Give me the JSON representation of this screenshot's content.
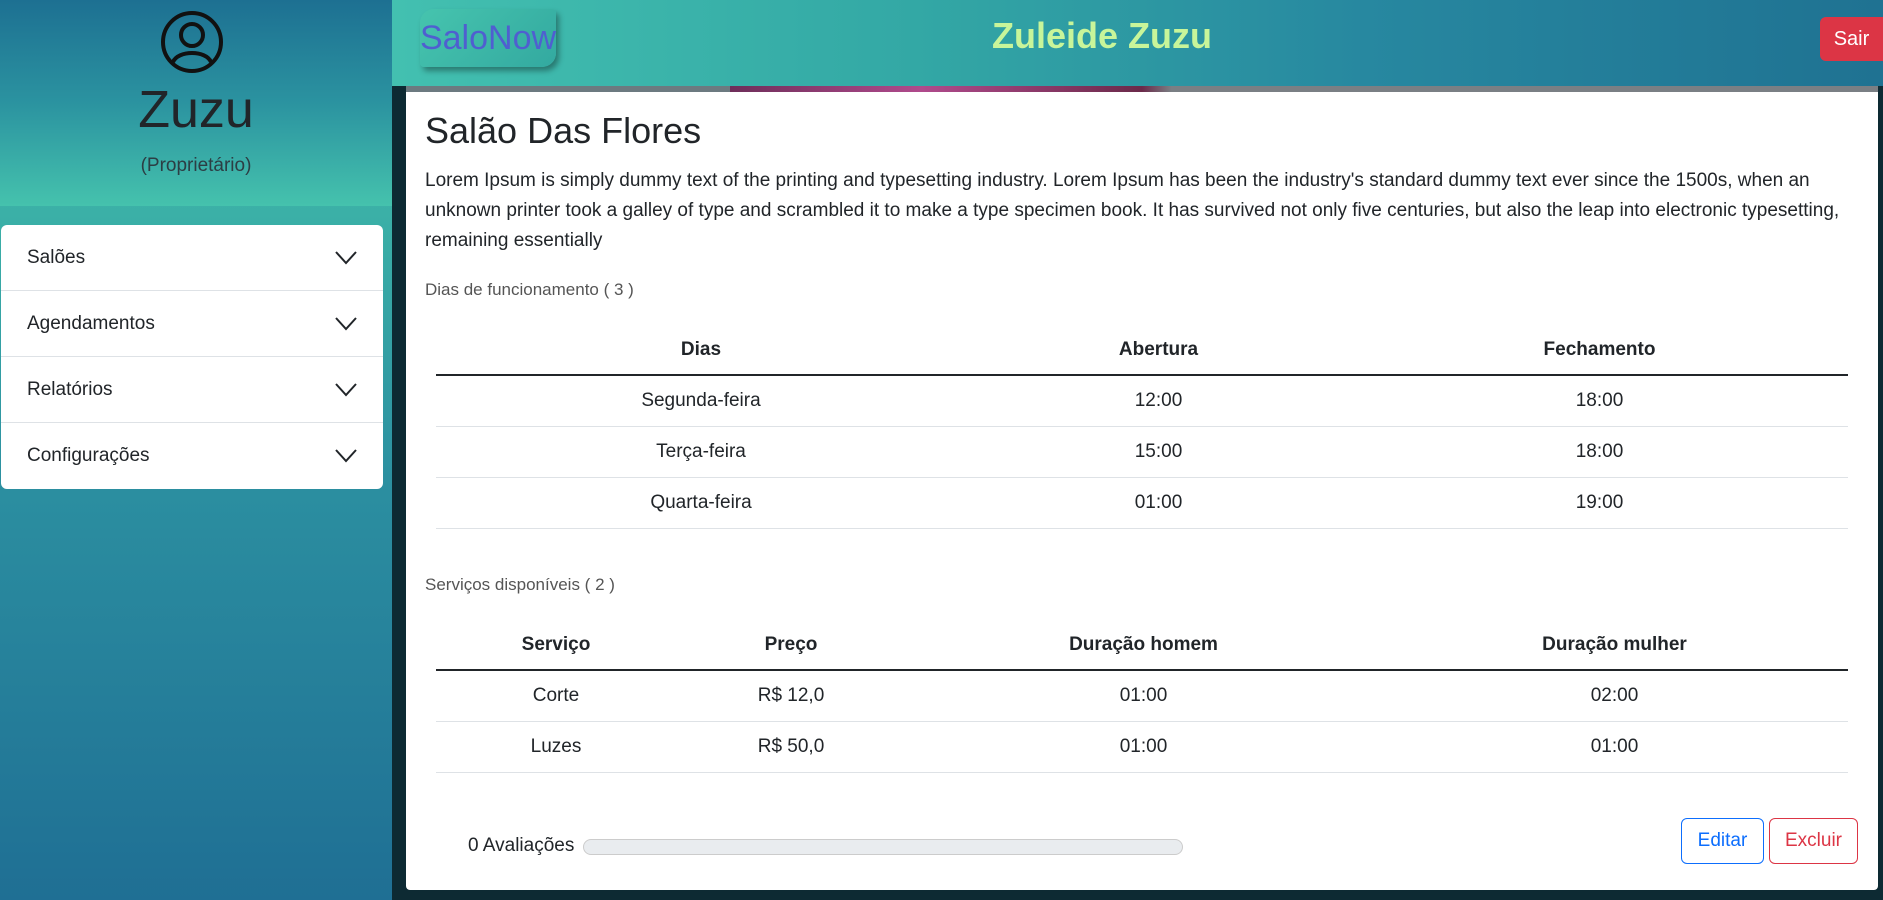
{
  "sidebar": {
    "user_name": "Zuzu",
    "user_role": "(Proprietário)",
    "menu": [
      {
        "label": "Salões"
      },
      {
        "label": "Agendamentos"
      },
      {
        "label": "Relatórios"
      },
      {
        "label": "Configurações"
      }
    ]
  },
  "header": {
    "brand": "SaloNow",
    "title": "Zuleide Zuzu",
    "logout_label": "Sair"
  },
  "salon": {
    "name": "Salão Das Flores",
    "description": "Lorem Ipsum is simply dummy text of the printing and typesetting industry. Lorem Ipsum has been the industry's standard dummy text ever since the 1500s, when an unknown printer took a galley of type and scrambled it to make a type specimen book. It has survived not only five centuries, but also the leap into electronic typesetting, remaining essentially"
  },
  "hours": {
    "label": "Dias de funcionamento ( 3 )",
    "headers": [
      "Dias",
      "Abertura",
      "Fechamento"
    ],
    "rows": [
      [
        "Segunda-feira",
        "12:00",
        "18:00"
      ],
      [
        "Terça-feira",
        "15:00",
        "18:00"
      ],
      [
        "Quarta-feira",
        "01:00",
        "19:00"
      ]
    ]
  },
  "services": {
    "label": "Serviços disponíveis ( 2 )",
    "headers": [
      "Serviço",
      "Preço",
      "Duração homem",
      "Duração mulher"
    ],
    "rows": [
      [
        "Corte",
        "R$ 12,0",
        "01:00",
        "02:00"
      ],
      [
        "Luzes",
        "R$ 50,0",
        "01:00",
        "01:00"
      ]
    ]
  },
  "ratings": {
    "label": "0 Avaliações",
    "progress": 0
  },
  "actions": {
    "edit_label": "Editar",
    "delete_label": "Excluir"
  },
  "colors": {
    "header_title": "#c8f59a",
    "brand_text": "#4f5fd0",
    "danger": "#dc3545",
    "primary": "#0d6efd"
  }
}
